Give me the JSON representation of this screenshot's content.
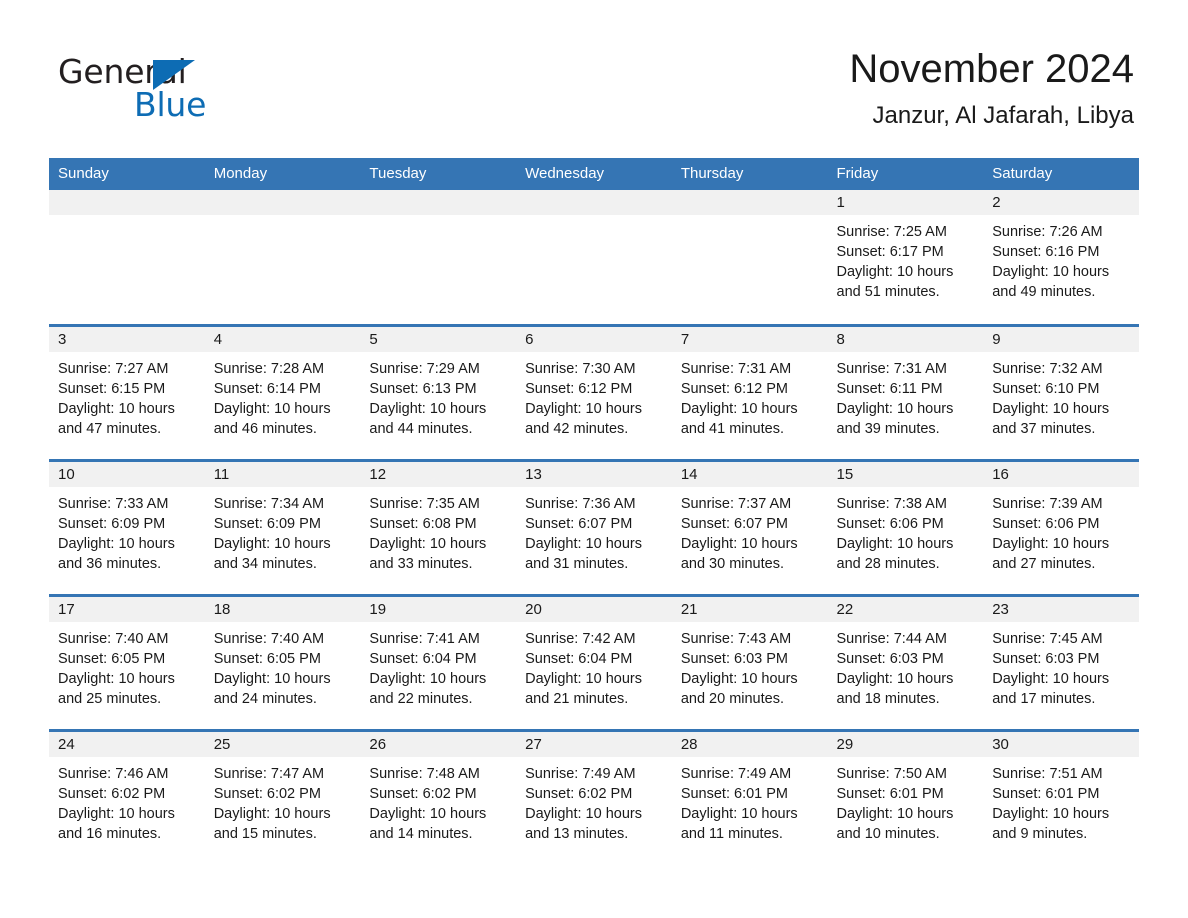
{
  "logo": {
    "word1": "General",
    "word2": "Blue",
    "triangle_color": "#0d6cb4"
  },
  "header": {
    "title": "November 2024",
    "subtitle": "Janzur, Al Jafarah, Libya"
  },
  "theme": {
    "header_blue": "#3575b4",
    "row_divider_blue": "#3575b4",
    "daynum_band": "#f1f1f1",
    "page_background": "#ffffff",
    "text": "#1a1a1a"
  },
  "weekday_headers": [
    "Sunday",
    "Monday",
    "Tuesday",
    "Wednesday",
    "Thursday",
    "Friday",
    "Saturday"
  ],
  "weeks": [
    [
      {
        "day": "",
        "empty": true
      },
      {
        "day": "",
        "empty": true
      },
      {
        "day": "",
        "empty": true
      },
      {
        "day": "",
        "empty": true
      },
      {
        "day": "",
        "empty": true
      },
      {
        "day": "1",
        "sunrise": "Sunrise: 7:25 AM",
        "sunset": "Sunset: 6:17 PM",
        "daylight1": "Daylight: 10 hours",
        "daylight2": "and 51 minutes."
      },
      {
        "day": "2",
        "sunrise": "Sunrise: 7:26 AM",
        "sunset": "Sunset: 6:16 PM",
        "daylight1": "Daylight: 10 hours",
        "daylight2": "and 49 minutes."
      }
    ],
    [
      {
        "day": "3",
        "sunrise": "Sunrise: 7:27 AM",
        "sunset": "Sunset: 6:15 PM",
        "daylight1": "Daylight: 10 hours",
        "daylight2": "and 47 minutes."
      },
      {
        "day": "4",
        "sunrise": "Sunrise: 7:28 AM",
        "sunset": "Sunset: 6:14 PM",
        "daylight1": "Daylight: 10 hours",
        "daylight2": "and 46 minutes."
      },
      {
        "day": "5",
        "sunrise": "Sunrise: 7:29 AM",
        "sunset": "Sunset: 6:13 PM",
        "daylight1": "Daylight: 10 hours",
        "daylight2": "and 44 minutes."
      },
      {
        "day": "6",
        "sunrise": "Sunrise: 7:30 AM",
        "sunset": "Sunset: 6:12 PM",
        "daylight1": "Daylight: 10 hours",
        "daylight2": "and 42 minutes."
      },
      {
        "day": "7",
        "sunrise": "Sunrise: 7:31 AM",
        "sunset": "Sunset: 6:12 PM",
        "daylight1": "Daylight: 10 hours",
        "daylight2": "and 41 minutes."
      },
      {
        "day": "8",
        "sunrise": "Sunrise: 7:31 AM",
        "sunset": "Sunset: 6:11 PM",
        "daylight1": "Daylight: 10 hours",
        "daylight2": "and 39 minutes."
      },
      {
        "day": "9",
        "sunrise": "Sunrise: 7:32 AM",
        "sunset": "Sunset: 6:10 PM",
        "daylight1": "Daylight: 10 hours",
        "daylight2": "and 37 minutes."
      }
    ],
    [
      {
        "day": "10",
        "sunrise": "Sunrise: 7:33 AM",
        "sunset": "Sunset: 6:09 PM",
        "daylight1": "Daylight: 10 hours",
        "daylight2": "and 36 minutes."
      },
      {
        "day": "11",
        "sunrise": "Sunrise: 7:34 AM",
        "sunset": "Sunset: 6:09 PM",
        "daylight1": "Daylight: 10 hours",
        "daylight2": "and 34 minutes."
      },
      {
        "day": "12",
        "sunrise": "Sunrise: 7:35 AM",
        "sunset": "Sunset: 6:08 PM",
        "daylight1": "Daylight: 10 hours",
        "daylight2": "and 33 minutes."
      },
      {
        "day": "13",
        "sunrise": "Sunrise: 7:36 AM",
        "sunset": "Sunset: 6:07 PM",
        "daylight1": "Daylight: 10 hours",
        "daylight2": "and 31 minutes."
      },
      {
        "day": "14",
        "sunrise": "Sunrise: 7:37 AM",
        "sunset": "Sunset: 6:07 PM",
        "daylight1": "Daylight: 10 hours",
        "daylight2": "and 30 minutes."
      },
      {
        "day": "15",
        "sunrise": "Sunrise: 7:38 AM",
        "sunset": "Sunset: 6:06 PM",
        "daylight1": "Daylight: 10 hours",
        "daylight2": "and 28 minutes."
      },
      {
        "day": "16",
        "sunrise": "Sunrise: 7:39 AM",
        "sunset": "Sunset: 6:06 PM",
        "daylight1": "Daylight: 10 hours",
        "daylight2": "and 27 minutes."
      }
    ],
    [
      {
        "day": "17",
        "sunrise": "Sunrise: 7:40 AM",
        "sunset": "Sunset: 6:05 PM",
        "daylight1": "Daylight: 10 hours",
        "daylight2": "and 25 minutes."
      },
      {
        "day": "18",
        "sunrise": "Sunrise: 7:40 AM",
        "sunset": "Sunset: 6:05 PM",
        "daylight1": "Daylight: 10 hours",
        "daylight2": "and 24 minutes."
      },
      {
        "day": "19",
        "sunrise": "Sunrise: 7:41 AM",
        "sunset": "Sunset: 6:04 PM",
        "daylight1": "Daylight: 10 hours",
        "daylight2": "and 22 minutes."
      },
      {
        "day": "20",
        "sunrise": "Sunrise: 7:42 AM",
        "sunset": "Sunset: 6:04 PM",
        "daylight1": "Daylight: 10 hours",
        "daylight2": "and 21 minutes."
      },
      {
        "day": "21",
        "sunrise": "Sunrise: 7:43 AM",
        "sunset": "Sunset: 6:03 PM",
        "daylight1": "Daylight: 10 hours",
        "daylight2": "and 20 minutes."
      },
      {
        "day": "22",
        "sunrise": "Sunrise: 7:44 AM",
        "sunset": "Sunset: 6:03 PM",
        "daylight1": "Daylight: 10 hours",
        "daylight2": "and 18 minutes."
      },
      {
        "day": "23",
        "sunrise": "Sunrise: 7:45 AM",
        "sunset": "Sunset: 6:03 PM",
        "daylight1": "Daylight: 10 hours",
        "daylight2": "and 17 minutes."
      }
    ],
    [
      {
        "day": "24",
        "sunrise": "Sunrise: 7:46 AM",
        "sunset": "Sunset: 6:02 PM",
        "daylight1": "Daylight: 10 hours",
        "daylight2": "and 16 minutes."
      },
      {
        "day": "25",
        "sunrise": "Sunrise: 7:47 AM",
        "sunset": "Sunset: 6:02 PM",
        "daylight1": "Daylight: 10 hours",
        "daylight2": "and 15 minutes."
      },
      {
        "day": "26",
        "sunrise": "Sunrise: 7:48 AM",
        "sunset": "Sunset: 6:02 PM",
        "daylight1": "Daylight: 10 hours",
        "daylight2": "and 14 minutes."
      },
      {
        "day": "27",
        "sunrise": "Sunrise: 7:49 AM",
        "sunset": "Sunset: 6:02 PM",
        "daylight1": "Daylight: 10 hours",
        "daylight2": "and 13 minutes."
      },
      {
        "day": "28",
        "sunrise": "Sunrise: 7:49 AM",
        "sunset": "Sunset: 6:01 PM",
        "daylight1": "Daylight: 10 hours",
        "daylight2": "and 11 minutes."
      },
      {
        "day": "29",
        "sunrise": "Sunrise: 7:50 AM",
        "sunset": "Sunset: 6:01 PM",
        "daylight1": "Daylight: 10 hours",
        "daylight2": "and 10 minutes."
      },
      {
        "day": "30",
        "sunrise": "Sunrise: 7:51 AM",
        "sunset": "Sunset: 6:01 PM",
        "daylight1": "Daylight: 10 hours",
        "daylight2": "and 9 minutes."
      }
    ]
  ]
}
